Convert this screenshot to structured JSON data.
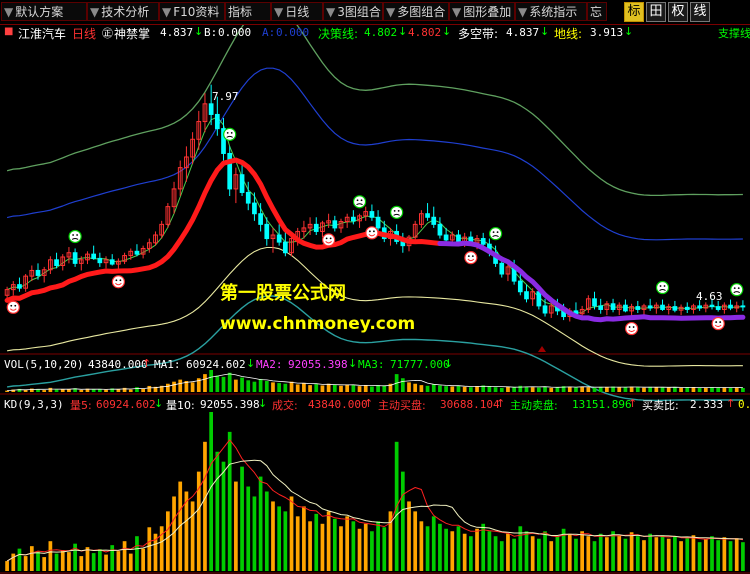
{
  "toolbar": {
    "buttons": [
      "默认方案",
      "技术分析",
      "F10资料",
      "指标",
      "日线",
      "3图组合",
      "多图组合",
      "图形叠加",
      "系统指示",
      "忘"
    ],
    "right_icons": [
      "标",
      "田",
      "权",
      "线"
    ]
  },
  "main_header": {
    "stock_name": "江淮汽车",
    "period": "日线",
    "indicator_name": "神禁掌",
    "indicator_value": "4.837",
    "b_label": "B:",
    "b_value": "0.000",
    "a_label": "A:",
    "a_value": "0.000",
    "decision_label": "决策线:",
    "decision_value": "4.802",
    "decision_value2": "4.802",
    "longshort_label": "多空带:",
    "longshort_value": "4.837",
    "ground_label": "地线:",
    "ground_value": "3.913",
    "support_label": "支撑线"
  },
  "price_labels": {
    "high": "7.97",
    "low": "4.63"
  },
  "watermark": {
    "line1": "第一股票公式网",
    "line2": "www.chnmoney.com"
  },
  "vol_header": {
    "label": "VOL(5,10,20)",
    "vol": "43840.000",
    "ma1_label": "MA1:",
    "ma1": "60924.602",
    "ma2_label": "MA2:",
    "ma2": "92055.398",
    "ma3_label": "MA3:",
    "ma3": "71777.000"
  },
  "kd_header": {
    "label": "KD(9,3,3)",
    "l5_label": "量5:",
    "l5": "60924.602",
    "l10_label": "量10:",
    "l10": "92055.398",
    "vol_label": "成交:",
    "vol": "43840.000",
    "buy_label": "主动买盘:",
    "buy": "30688.104",
    "sell_label": "主动卖盘:",
    "sell": "13151.896",
    "ratio_label": "买卖比:",
    "ratio": "2.333",
    "tail": "0."
  },
  "colors": {
    "up": "#ff3232",
    "down": "#00ffff",
    "vol_up": "#ffa500",
    "vol_down": "#00cc00",
    "decision_red": "#ff1a1a",
    "decision_purple": "#8a2be2",
    "band_outer": "#5fa05f",
    "band_blue": "#1f3fd0",
    "band_yellow": "#e8e8a0",
    "band_teal": "#2aa0a0",
    "face": "#ffffff"
  },
  "chart_data": {
    "type": "candlestick",
    "n": 120,
    "price_ylim": [
      4.2,
      8.6
    ],
    "candles": [
      [
        5.0,
        5.12,
        4.92,
        5.08
      ],
      [
        5.08,
        5.2,
        5.0,
        5.15
      ],
      [
        5.15,
        5.25,
        5.05,
        5.1
      ],
      [
        5.1,
        5.3,
        5.05,
        5.27
      ],
      [
        5.27,
        5.42,
        5.2,
        5.35
      ],
      [
        5.35,
        5.45,
        5.22,
        5.28
      ],
      [
        5.28,
        5.4,
        5.18,
        5.36
      ],
      [
        5.36,
        5.55,
        5.3,
        5.5
      ],
      [
        5.5,
        5.6,
        5.38,
        5.42
      ],
      [
        5.42,
        5.58,
        5.35,
        5.54
      ],
      [
        5.54,
        5.68,
        5.45,
        5.6
      ],
      [
        5.6,
        5.66,
        5.4,
        5.45
      ],
      [
        5.45,
        5.55,
        5.35,
        5.5
      ],
      [
        5.5,
        5.62,
        5.44,
        5.58
      ],
      [
        5.58,
        5.7,
        5.5,
        5.52
      ],
      [
        5.52,
        5.6,
        5.4,
        5.46
      ],
      [
        5.46,
        5.55,
        5.38,
        5.5
      ],
      [
        5.5,
        5.58,
        5.42,
        5.44
      ],
      [
        5.44,
        5.52,
        5.36,
        5.48
      ],
      [
        5.48,
        5.6,
        5.44,
        5.56
      ],
      [
        5.56,
        5.66,
        5.5,
        5.62
      ],
      [
        5.62,
        5.72,
        5.55,
        5.58
      ],
      [
        5.58,
        5.7,
        5.52,
        5.66
      ],
      [
        5.66,
        5.8,
        5.6,
        5.74
      ],
      [
        5.74,
        5.9,
        5.7,
        5.85
      ],
      [
        5.85,
        6.05,
        5.8,
        6.0
      ],
      [
        6.0,
        6.3,
        5.95,
        6.25
      ],
      [
        6.25,
        6.6,
        6.15,
        6.5
      ],
      [
        6.5,
        6.9,
        6.4,
        6.8
      ],
      [
        6.8,
        7.1,
        6.6,
        6.95
      ],
      [
        6.95,
        7.3,
        6.85,
        7.2
      ],
      [
        7.2,
        7.6,
        7.05,
        7.45
      ],
      [
        7.45,
        7.85,
        7.3,
        7.7
      ],
      [
        7.7,
        7.97,
        7.4,
        7.55
      ],
      [
        7.55,
        7.8,
        7.25,
        7.35
      ],
      [
        7.35,
        7.5,
        6.9,
        7.0
      ],
      [
        7.0,
        7.1,
        6.4,
        6.5
      ],
      [
        6.5,
        6.8,
        6.3,
        6.7
      ],
      [
        6.7,
        6.85,
        6.4,
        6.45
      ],
      [
        6.45,
        6.6,
        6.2,
        6.3
      ],
      [
        6.3,
        6.45,
        6.05,
        6.15
      ],
      [
        6.15,
        6.3,
        5.9,
        6.0
      ],
      [
        6.0,
        6.1,
        5.7,
        5.8
      ],
      [
        5.8,
        5.95,
        5.6,
        5.85
      ],
      [
        5.85,
        6.0,
        5.7,
        5.75
      ],
      [
        5.75,
        5.9,
        5.55,
        5.6
      ],
      [
        5.6,
        5.85,
        5.55,
        5.8
      ],
      [
        5.8,
        5.95,
        5.7,
        5.9
      ],
      [
        5.9,
        6.05,
        5.8,
        5.95
      ],
      [
        5.95,
        6.1,
        5.85,
        6.0
      ],
      [
        6.0,
        6.1,
        5.85,
        5.9
      ],
      [
        5.9,
        6.05,
        5.82,
        6.02
      ],
      [
        6.02,
        6.15,
        5.95,
        6.05
      ],
      [
        6.05,
        6.12,
        5.9,
        5.95
      ],
      [
        5.95,
        6.08,
        5.88,
        6.04
      ],
      [
        6.04,
        6.15,
        5.95,
        6.1
      ],
      [
        6.1,
        6.2,
        6.0,
        6.05
      ],
      [
        6.05,
        6.15,
        5.95,
        6.12
      ],
      [
        6.12,
        6.25,
        6.05,
        6.18
      ],
      [
        6.18,
        6.28,
        6.05,
        6.1
      ],
      [
        6.1,
        6.2,
        5.9,
        5.95
      ],
      [
        5.95,
        6.05,
        5.75,
        5.8
      ],
      [
        5.8,
        5.95,
        5.7,
        5.9
      ],
      [
        5.9,
        6.0,
        5.72,
        5.76
      ],
      [
        5.76,
        5.88,
        5.6,
        5.7
      ],
      [
        5.7,
        5.85,
        5.62,
        5.82
      ],
      [
        5.82,
        6.05,
        5.78,
        6.0
      ],
      [
        6.0,
        6.2,
        5.95,
        6.15
      ],
      [
        6.15,
        6.3,
        6.05,
        6.1
      ],
      [
        6.1,
        6.25,
        5.95,
        6.0
      ],
      [
        6.0,
        6.1,
        5.8,
        5.85
      ],
      [
        5.85,
        5.95,
        5.7,
        5.78
      ],
      [
        5.78,
        5.9,
        5.7,
        5.85
      ],
      [
        5.85,
        5.92,
        5.72,
        5.75
      ],
      [
        5.75,
        5.88,
        5.68,
        5.82
      ],
      [
        5.82,
        5.9,
        5.7,
        5.74
      ],
      [
        5.74,
        5.85,
        5.65,
        5.8
      ],
      [
        5.8,
        5.88,
        5.68,
        5.72
      ],
      [
        5.72,
        5.8,
        5.55,
        5.6
      ],
      [
        5.6,
        5.7,
        5.4,
        5.45
      ],
      [
        5.45,
        5.55,
        5.25,
        5.3
      ],
      [
        5.3,
        5.45,
        5.2,
        5.4
      ],
      [
        5.4,
        5.5,
        5.15,
        5.2
      ],
      [
        5.2,
        5.3,
        5.0,
        5.05
      ],
      [
        5.05,
        5.15,
        4.9,
        4.95
      ],
      [
        4.95,
        5.1,
        4.85,
        5.05
      ],
      [
        5.05,
        5.12,
        4.8,
        4.85
      ],
      [
        4.85,
        4.95,
        4.7,
        4.75
      ],
      [
        4.75,
        4.9,
        4.68,
        4.85
      ],
      [
        4.85,
        4.95,
        4.72,
        4.78
      ],
      [
        4.78,
        4.88,
        4.65,
        4.7
      ],
      [
        4.7,
        4.82,
        4.63,
        4.78
      ],
      [
        4.78,
        4.9,
        4.7,
        4.74
      ],
      [
        4.74,
        4.85,
        4.66,
        4.8
      ],
      [
        4.8,
        5.0,
        4.75,
        4.95
      ],
      [
        4.95,
        5.05,
        4.8,
        4.85
      ],
      [
        4.85,
        4.95,
        4.74,
        4.8
      ],
      [
        4.8,
        4.92,
        4.72,
        4.88
      ],
      [
        4.88,
        4.95,
        4.76,
        4.8
      ],
      [
        4.8,
        4.9,
        4.72,
        4.86
      ],
      [
        4.86,
        4.94,
        4.76,
        4.78
      ],
      [
        4.78,
        4.88,
        4.7,
        4.84
      ],
      [
        4.84,
        4.92,
        4.75,
        4.8
      ],
      [
        4.8,
        4.88,
        4.72,
        4.85
      ],
      [
        4.85,
        4.95,
        4.78,
        4.82
      ],
      [
        4.82,
        4.9,
        4.74,
        4.86
      ],
      [
        4.86,
        4.94,
        4.78,
        4.8
      ],
      [
        4.8,
        4.88,
        4.73,
        4.84
      ],
      [
        4.84,
        4.92,
        4.76,
        4.79
      ],
      [
        4.79,
        4.87,
        4.72,
        4.83
      ],
      [
        4.83,
        4.9,
        4.75,
        4.8
      ],
      [
        4.8,
        4.88,
        4.74,
        4.85
      ],
      [
        4.85,
        4.93,
        4.78,
        4.82
      ],
      [
        4.82,
        4.9,
        4.76,
        4.86
      ],
      [
        4.86,
        4.95,
        4.8,
        4.84
      ],
      [
        4.84,
        4.92,
        4.77,
        4.8
      ],
      [
        4.8,
        4.9,
        4.74,
        4.86
      ],
      [
        4.86,
        4.94,
        4.79,
        4.82
      ],
      [
        4.82,
        4.91,
        4.76,
        4.85
      ],
      [
        4.85,
        4.93,
        4.78,
        4.84
      ]
    ],
    "volumes": [
      20,
      35,
      45,
      30,
      50,
      40,
      28,
      60,
      35,
      42,
      38,
      55,
      30,
      48,
      36,
      44,
      33,
      52,
      40,
      60,
      35,
      70,
      45,
      88,
      75,
      90,
      120,
      150,
      180,
      160,
      140,
      200,
      260,
      320,
      240,
      220,
      280,
      180,
      210,
      170,
      150,
      190,
      160,
      140,
      130,
      120,
      150,
      110,
      130,
      100,
      115,
      95,
      120,
      105,
      90,
      110,
      100,
      85,
      95,
      80,
      100,
      88,
      120,
      260,
      200,
      140,
      120,
      100,
      90,
      110,
      95,
      85,
      80,
      90,
      75,
      70,
      85,
      95,
      80,
      70,
      60,
      75,
      65,
      90,
      80,
      70,
      65,
      80,
      60,
      70,
      85,
      75,
      65,
      80,
      70,
      60,
      75,
      68,
      80,
      72,
      65,
      78,
      70,
      62,
      75,
      68,
      72,
      65,
      70,
      60,
      66,
      72,
      58,
      64,
      70,
      62,
      68,
      60,
      66,
      58
    ],
    "markers": [
      {
        "i": 1,
        "type": "happy"
      },
      {
        "i": 11,
        "type": "neutral"
      },
      {
        "i": 18,
        "type": "happy"
      },
      {
        "i": 36,
        "type": "neutral"
      },
      {
        "i": 52,
        "type": "happy"
      },
      {
        "i": 57,
        "type": "neutral"
      },
      {
        "i": 59,
        "type": "happy"
      },
      {
        "i": 63,
        "type": "neutral"
      },
      {
        "i": 75,
        "type": "happy"
      },
      {
        "i": 79,
        "type": "neutral"
      },
      {
        "i": 101,
        "type": "happy"
      },
      {
        "i": 106,
        "type": "neutral"
      },
      {
        "i": 115,
        "type": "happy"
      },
      {
        "i": 118,
        "type": "neutral"
      }
    ]
  }
}
